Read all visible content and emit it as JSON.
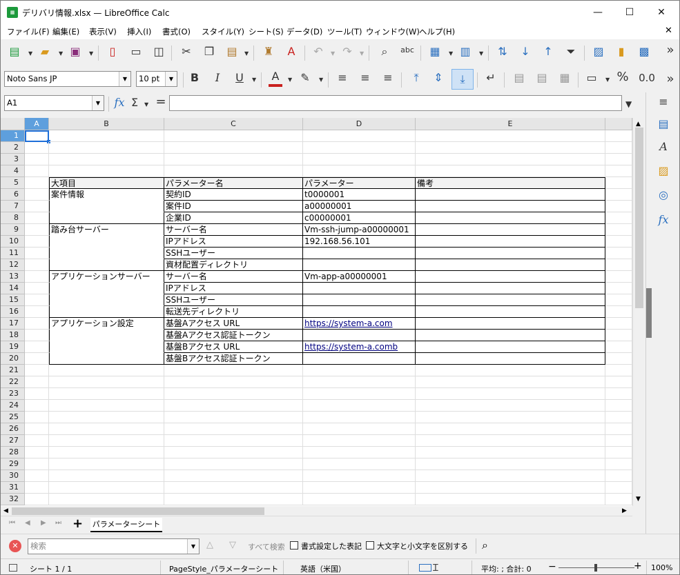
{
  "window": {
    "title": "デリバリ情報.xlsx — LibreOffice Calc",
    "app_icon_text": "Calc",
    "minimize": "—",
    "maximize": "☐",
    "close": "✕"
  },
  "menubar": {
    "items": [
      "ファイル(F)",
      "編集(E)",
      "表示(V)",
      "挿入(I)",
      "書式(O)",
      "スタイル(Y)",
      "シート(S)",
      "データ(D)",
      "ツール(T)",
      "ウィンドウ(W)",
      "ヘルプ(H)"
    ],
    "close_doc": "✕"
  },
  "toolbar2": {
    "font_name": "Noto Sans JP",
    "font_size": "10 pt",
    "bold": "B",
    "italic": "I",
    "underline": "U",
    "font_color": "A",
    "percent": "%",
    "decimal": "0.0",
    "more": "»"
  },
  "toolbar1": {
    "more": "»",
    "spell": "abc"
  },
  "formulabar": {
    "name_box": "A1",
    "fx": "fx",
    "sum": "Σ",
    "equals": "=",
    "formula": ""
  },
  "sheet": {
    "columns": [
      "A",
      "B",
      "C",
      "D",
      "E"
    ],
    "row_numbers": [
      "1",
      "2",
      "3",
      "4",
      "5",
      "6",
      "7",
      "8",
      "9",
      "10",
      "11",
      "12",
      "13",
      "14",
      "15",
      "16",
      "17",
      "18",
      "19",
      "20",
      "21",
      "22",
      "23",
      "24",
      "25",
      "26",
      "27",
      "28",
      "29",
      "30",
      "31",
      "32"
    ],
    "header_row": [
      "大項目",
      "パラメーター名",
      "パラメーター",
      "備考"
    ],
    "rows": [
      {
        "b": "案件情報",
        "c": "契約ID",
        "d": "t0000001",
        "e": ""
      },
      {
        "b": "",
        "c": "案件ID",
        "d": "a00000001",
        "e": ""
      },
      {
        "b": "",
        "c": "企業ID",
        "d": "c00000001",
        "e": ""
      },
      {
        "b": "踏み台サーバー",
        "c": "サーバー名",
        "d": "Vm-ssh-jump-a00000001",
        "e": ""
      },
      {
        "b": "",
        "c": "IPアドレス",
        "d": "192.168.56.101",
        "e": ""
      },
      {
        "b": "",
        "c": "SSHユーザー",
        "d": "",
        "e": ""
      },
      {
        "b": "",
        "c": "資材配置ディレクトリ",
        "d": "",
        "e": ""
      },
      {
        "b": "アプリケーションサーバー",
        "c": "サーバー名",
        "d": "Vm-app-a00000001",
        "e": ""
      },
      {
        "b": "",
        "c": "IPアドレス",
        "d": "",
        "e": ""
      },
      {
        "b": "",
        "c": "SSHユーザー",
        "d": "",
        "e": ""
      },
      {
        "b": "",
        "c": "転送先ディレクトリ",
        "d": "",
        "e": ""
      },
      {
        "b": "アプリケーション設定",
        "c": "基盤Aアクセス URL",
        "d": "https://system-a.com",
        "e": ""
      },
      {
        "b": "",
        "c": "基盤Aアクセス認証トークン",
        "d": "",
        "e": ""
      },
      {
        "b": "",
        "c": "基盤Bアクセス URL",
        "d": "https://system-a.comb",
        "e": ""
      },
      {
        "b": "",
        "c": "基盤Bアクセス認証トークン",
        "d": "",
        "e": ""
      }
    ]
  },
  "tabs": {
    "add": "+",
    "sheet_name": "パラメーターシート"
  },
  "findbar": {
    "placeholder": "検索",
    "find_all": "すべて検索",
    "formatted_display": "書式設定した表記",
    "match_case": "大文字と小文字を区別する"
  },
  "statusbar": {
    "sheet": "シート 1 / 1",
    "page_style": "PageStyle_パラメーターシート",
    "language": "英語（米国）",
    "summary": "平均: ; 合計: 0",
    "zoom_minus": "−",
    "zoom_plus": "+",
    "zoom": "100%"
  },
  "colors": {
    "accent": "#1d9a3c",
    "selection": "#1e6fd9",
    "link": "#000080",
    "font_color_bar": "#c9211e"
  }
}
